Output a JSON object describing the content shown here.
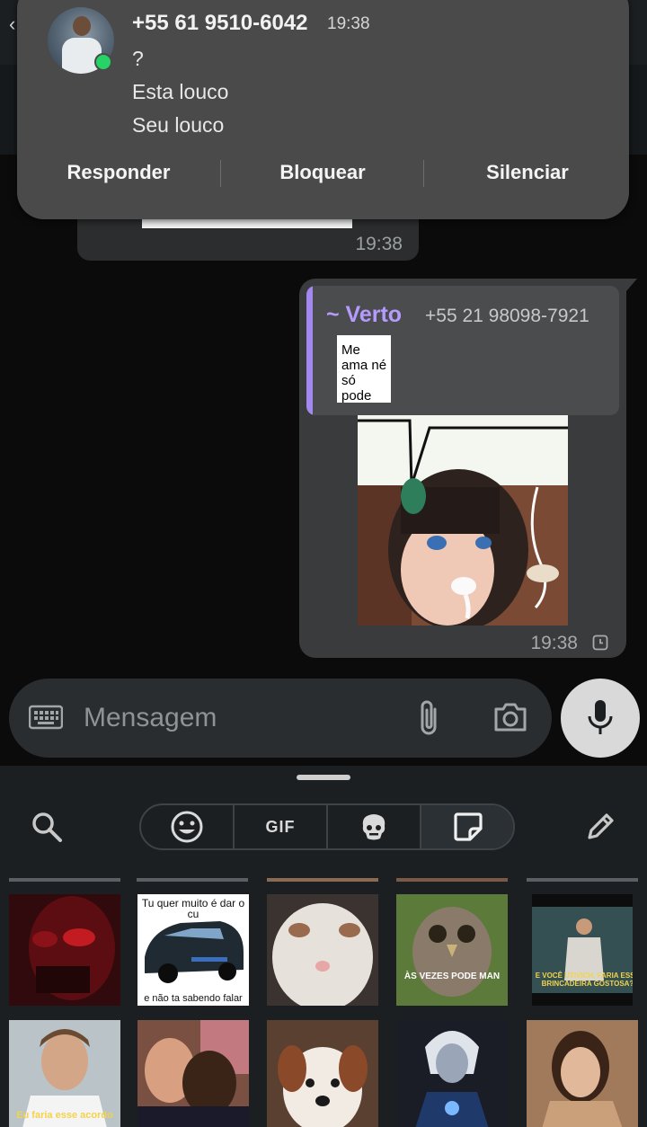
{
  "notification": {
    "title": "+55 61 9510-6042",
    "time": "19:38",
    "lines": [
      "?",
      "Esta louco",
      "Seu louco"
    ],
    "actions": [
      "Responder",
      "Bloquear",
      "Silenciar"
    ]
  },
  "incoming": {
    "time": "19:38"
  },
  "outgoing": {
    "quote_author": "~ Verto",
    "quote_phone": "+55 21 98098-7921",
    "quote_thumb_text": "Me ama né só pode",
    "time": "19:38"
  },
  "composer": {
    "placeholder": "Mensagem"
  },
  "sticker_panel": {
    "gif_label": "GIF",
    "captions": {
      "cars_top": "Tu quer muito é dar o cu",
      "cars_bottom": "e não ta sabendo falar",
      "owl": "ÀS VEZES PODE MAN",
      "suit": "E VOCÊ UTIVICH, FARIA ESSA BRINCADEIRA GOSTOSA?",
      "brad": "Eu faria esse acordo"
    }
  },
  "colors": {
    "accent_quote": "#a388f0",
    "whatsapp_green": "#25d366"
  }
}
